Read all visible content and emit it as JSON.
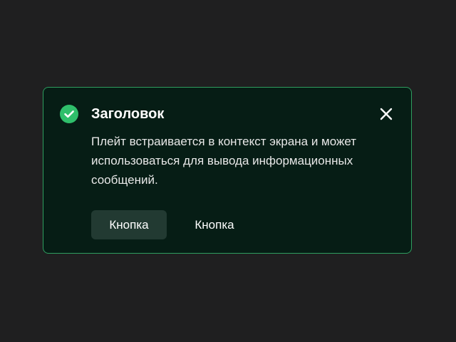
{
  "plate": {
    "status": "success",
    "status_icon": "check-circle-icon",
    "close_icon": "close-icon",
    "title": "Заголовок",
    "text": "Плейт встраивается в контекст экрана и может использоваться для вывода информационных сообщений.",
    "buttons": {
      "primary_label": "Кнопка",
      "secondary_label": "Кнопка"
    }
  },
  "colors": {
    "background": "#1f1f20",
    "plate_background": "#061d15",
    "plate_border": "#2e9e5f",
    "success_icon": "#2fbf6b",
    "primary_button": "#223a32",
    "text": "#ffffff"
  }
}
